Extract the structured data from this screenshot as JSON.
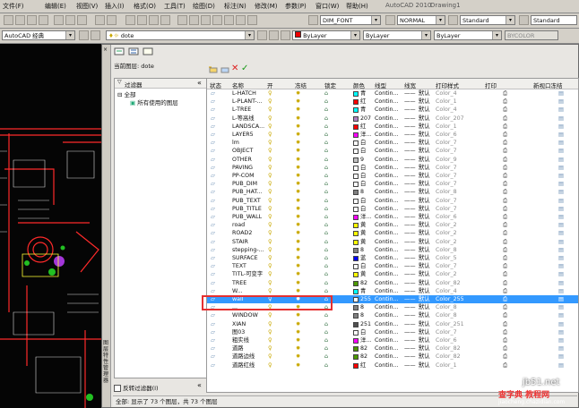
{
  "menubar": {
    "items": [
      "文件(F)",
      "编辑(E)",
      "视图(V)",
      "插入(I)",
      "格式(O)",
      "工具(T)",
      "绘图(D)",
      "标注(N)",
      "修改(M)",
      "参数(P)",
      "窗口(W)",
      "帮助(H)"
    ],
    "app_title": "AutoCAD 2010",
    "file_name": "Drawing1"
  },
  "toolbar2": {
    "dimstyle": "DIM_FONT",
    "textstyle": "NORMAL",
    "tablestyle": "Standard",
    "mleaderstyle": "Standard"
  },
  "toolbar3": {
    "workspace": "AutoCAD 经典",
    "current_layer": "dote",
    "color": "ByLayer",
    "linetype": "ByLayer",
    "lineweight": "ByLayer",
    "plotstyle": "BYCOLOR"
  },
  "dialog": {
    "title_label": "当前图层: dote",
    "filter_header": "过滤器",
    "tree_all": "全部",
    "tree_used": "所有使用的图层",
    "invert_filter": "反转过滤器(I)",
    "status": "全部: 显示了 73 个图层，共 73 个图层",
    "columns": [
      "状态",
      "名称",
      "开",
      "冻结",
      "锁定",
      "颜色",
      "线型",
      "线宽",
      "打印样式",
      "打印",
      "新视口冻结"
    ],
    "collapse": "«"
  },
  "rows": [
    {
      "name": "L-HATCH",
      "color_name": "青",
      "swatch": "#00ffff",
      "lt": "Contin...",
      "lw": "默认",
      "ps": "Color_4"
    },
    {
      "name": "L-PLANT-...",
      "color_name": "红",
      "swatch": "#ff0000",
      "lt": "Contin...",
      "lw": "默认",
      "ps": "Color_1"
    },
    {
      "name": "L-TREE",
      "color_name": "青",
      "swatch": "#00ffff",
      "lt": "Contin...",
      "lw": "默认",
      "ps": "Color_4"
    },
    {
      "name": "L-等高线",
      "color_name": "207",
      "swatch": "#b080c0",
      "lt": "Contin...",
      "lw": "默认",
      "ps": "Color_207"
    },
    {
      "name": "LANDSCA...",
      "color_name": "红",
      "swatch": "#ff0000",
      "lt": "Contin...",
      "lw": "默认",
      "ps": "Color_1"
    },
    {
      "name": "LAYER5",
      "color_name": "洋...",
      "swatch": "#ff00ff",
      "lt": "Contin...",
      "lw": "默认",
      "ps": "Color_6"
    },
    {
      "name": "lm",
      "color_name": "白",
      "swatch": "#ffffff",
      "lt": "Contin...",
      "lw": "默认",
      "ps": "Color_7"
    },
    {
      "name": "OBJECT",
      "color_name": "白",
      "swatch": "#ffffff",
      "lt": "Contin...",
      "lw": "默认",
      "ps": "Color_7"
    },
    {
      "name": "OTHER",
      "color_name": "9",
      "swatch": "#c0c0c0",
      "lt": "Contin...",
      "lw": "默认",
      "ps": "Color_9"
    },
    {
      "name": "PAVING",
      "color_name": "白",
      "swatch": "#ffffff",
      "lt": "Contin...",
      "lw": "默认",
      "ps": "Color_7"
    },
    {
      "name": "PP-COM",
      "color_name": "白",
      "swatch": "#ffffff",
      "lt": "Contin...",
      "lw": "默认",
      "ps": "Color_7"
    },
    {
      "name": "PUB_DIM",
      "color_name": "白",
      "swatch": "#ffffff",
      "lt": "Contin...",
      "lw": "默认",
      "ps": "Color_7"
    },
    {
      "name": "PUB_HAT...",
      "color_name": "8",
      "swatch": "#808080",
      "lt": "Contin...",
      "lw": "默认",
      "ps": "Color_8"
    },
    {
      "name": "PUB_TEXT",
      "color_name": "白",
      "swatch": "#ffffff",
      "lt": "Contin...",
      "lw": "默认",
      "ps": "Color_7"
    },
    {
      "name": "PUB_TITLE",
      "color_name": "白",
      "swatch": "#ffffff",
      "lt": "Contin...",
      "lw": "默认",
      "ps": "Color_7"
    },
    {
      "name": "PUB_WALL",
      "color_name": "洋...",
      "swatch": "#ff00ff",
      "lt": "Contin...",
      "lw": "默认",
      "ps": "Color_6"
    },
    {
      "name": "road",
      "color_name": "黄",
      "swatch": "#ffff00",
      "lt": "Contin...",
      "lw": "默认",
      "ps": "Color_2"
    },
    {
      "name": "ROAD2",
      "color_name": "黄",
      "swatch": "#ffff00",
      "lt": "Contin...",
      "lw": "默认",
      "ps": "Color_2"
    },
    {
      "name": "STAIR",
      "color_name": "黄",
      "swatch": "#ffff00",
      "lt": "Contin...",
      "lw": "默认",
      "ps": "Color_2"
    },
    {
      "name": "stepping-...",
      "color_name": "8",
      "swatch": "#808080",
      "lt": "Contin...",
      "lw": "默认",
      "ps": "Color_8"
    },
    {
      "name": "SURFACE",
      "color_name": "蓝",
      "swatch": "#0000ff",
      "lt": "Contin...",
      "lw": "默认",
      "ps": "Color_5"
    },
    {
      "name": "TEXT",
      "color_name": "白",
      "swatch": "#ffffff",
      "lt": "Contin...",
      "lw": "默认",
      "ps": "Color_7"
    },
    {
      "name": "TITL-可变字",
      "color_name": "黄",
      "swatch": "#ffff00",
      "lt": "Contin...",
      "lw": "默认",
      "ps": "Color_2"
    },
    {
      "name": "TREE",
      "color_name": "82",
      "swatch": "#4c9900",
      "lt": "Contin...",
      "lw": "默认",
      "ps": "Color_82"
    },
    {
      "name": "W...",
      "color_name": "青",
      "swatch": "#00ffff",
      "lt": "Contin...",
      "lw": "默认",
      "ps": "Color_4"
    },
    {
      "name": "wall",
      "color_name": "255",
      "swatch": "#ffffff",
      "lt": "Contin...",
      "lw": "默认",
      "ps": "Color_255",
      "selected": true
    },
    {
      "name": "...",
      "color_name": "8",
      "swatch": "#808080",
      "lt": "Contin...",
      "lw": "默认",
      "ps": "Color_8"
    },
    {
      "name": "WINDOW",
      "color_name": "8",
      "swatch": "#808080",
      "lt": "Contin...",
      "lw": "默认",
      "ps": "Color_8"
    },
    {
      "name": "XIAN",
      "color_name": "251",
      "swatch": "#505050",
      "lt": "Contin...",
      "lw": "默认",
      "ps": "Color_251"
    },
    {
      "name": "图03",
      "color_name": "白",
      "swatch": "#ffffff",
      "lt": "Contin...",
      "lw": "默认",
      "ps": "Color_7"
    },
    {
      "name": "粗实线",
      "color_name": "洋...",
      "swatch": "#ff00ff",
      "lt": "Contin...",
      "lw": "默认",
      "ps": "Color_6"
    },
    {
      "name": "道路",
      "color_name": "82",
      "swatch": "#4c9900",
      "lt": "Contin...",
      "lw": "默认",
      "ps": "Color_82"
    },
    {
      "name": "道路边线",
      "color_name": "82",
      "swatch": "#4c9900",
      "lt": "Contin...",
      "lw": "默认",
      "ps": "Color_82"
    },
    {
      "name": "道路红线",
      "color_name": "红",
      "swatch": "#ff0000",
      "lt": "Contin...",
      "lw": "默认",
      "ps": "Color_1"
    }
  ],
  "watermark": {
    "site1": "jb51.net",
    "site2": "查字典 教程网",
    "site3": "jiaocheng.chazidian.com"
  }
}
